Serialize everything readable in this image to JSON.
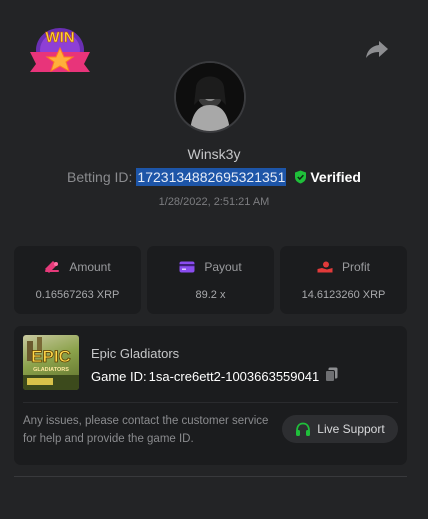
{
  "badge": {
    "text": "WIN"
  },
  "user": {
    "name": "Winsk3y",
    "betting_label": "Betting ID:",
    "betting_id": "1723134882695321351",
    "verified_label": "Verified",
    "timestamp": "1/28/2022, 2:51:21 AM"
  },
  "stats": [
    {
      "label": "Amount",
      "value": "0.16567263 XRP",
      "icon": "amount-icon"
    },
    {
      "label": "Payout",
      "value": "89.2 x",
      "icon": "payout-icon"
    },
    {
      "label": "Profit",
      "value": "14.6123260 XRP",
      "icon": "profit-icon"
    }
  ],
  "game": {
    "name": "Epic Gladiators",
    "id_label": "Game ID:",
    "id_value": "1sa-cre6ett2-1003663559041",
    "thumb_title": "EPIC",
    "thumb_subtitle": "GLADIATORS"
  },
  "support": {
    "message": "Any issues, please contact the customer service for help and provide the game ID.",
    "button_label": "Live Support"
  },
  "colors": {
    "background": "#232426",
    "card": "#1b1c1e",
    "verified_green": "#1fbf3a",
    "amount_pink": "#e63a7a",
    "payout_purple": "#8a4cf0",
    "profit_red": "#e23a3a",
    "selection_blue": "#1d55a8"
  }
}
